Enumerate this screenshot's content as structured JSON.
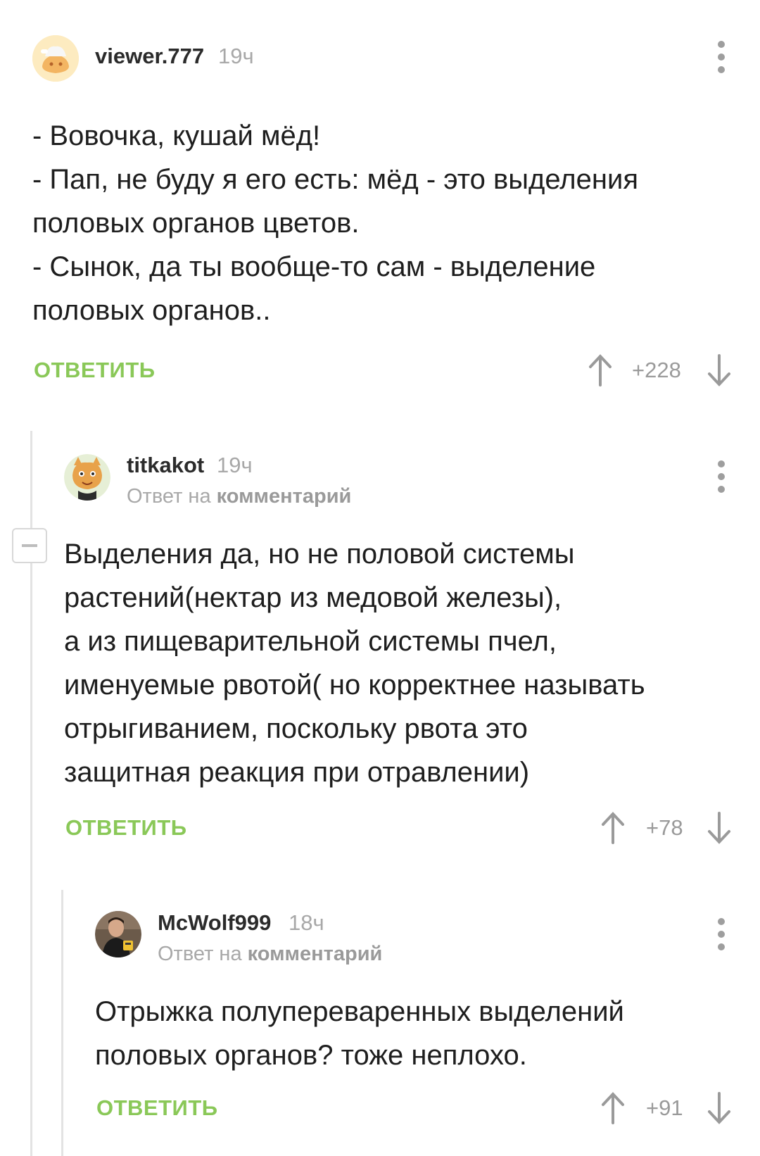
{
  "comments": [
    {
      "author": "viewer.777",
      "time": "19ч",
      "lines": [
        "- Вовочка, кушай мёд!",
        "- Пап, не буду я его есть: мёд - это выделения",
        "половых органов цветов.",
        "- Сынок, да ты вообще-то сам - выделение",
        "половых органов.."
      ],
      "reply_label": "ОТВЕТИТЬ",
      "score": "+228"
    },
    {
      "author": "titkakot",
      "time": "19ч",
      "reply_prefix": "Ответ на",
      "reply_target": "комментарий",
      "lines": [
        "Выделения да, но не половой системы",
        "растений(нектар из медовой железы),",
        "а из пищеварительной системы пчел,",
        "именуемые рвотой( но корректнее называть",
        "отрыгиванием, поскольку рвота это",
        "защитная реакция при отравлении)"
      ],
      "reply_label": "ОТВЕТИТЬ",
      "score": "+78"
    },
    {
      "author": "McWolf999",
      "time": "18ч",
      "reply_prefix": "Ответ на",
      "reply_target": "комментарий",
      "lines": [
        "Отрыжка полупереваренных выделений",
        "половых органов? тоже неплохо."
      ],
      "reply_label": "ОТВЕТИТЬ",
      "score": "+91"
    }
  ],
  "colors": {
    "accent_green": "#8ac858",
    "muted_text": "#a8a8a8",
    "thread_line": "#e3e3e3"
  },
  "icons": {
    "menu": "vertical-dots-icon",
    "upvote": "arrow-up-icon",
    "downvote": "arrow-down-icon",
    "collapse": "minus-icon"
  }
}
